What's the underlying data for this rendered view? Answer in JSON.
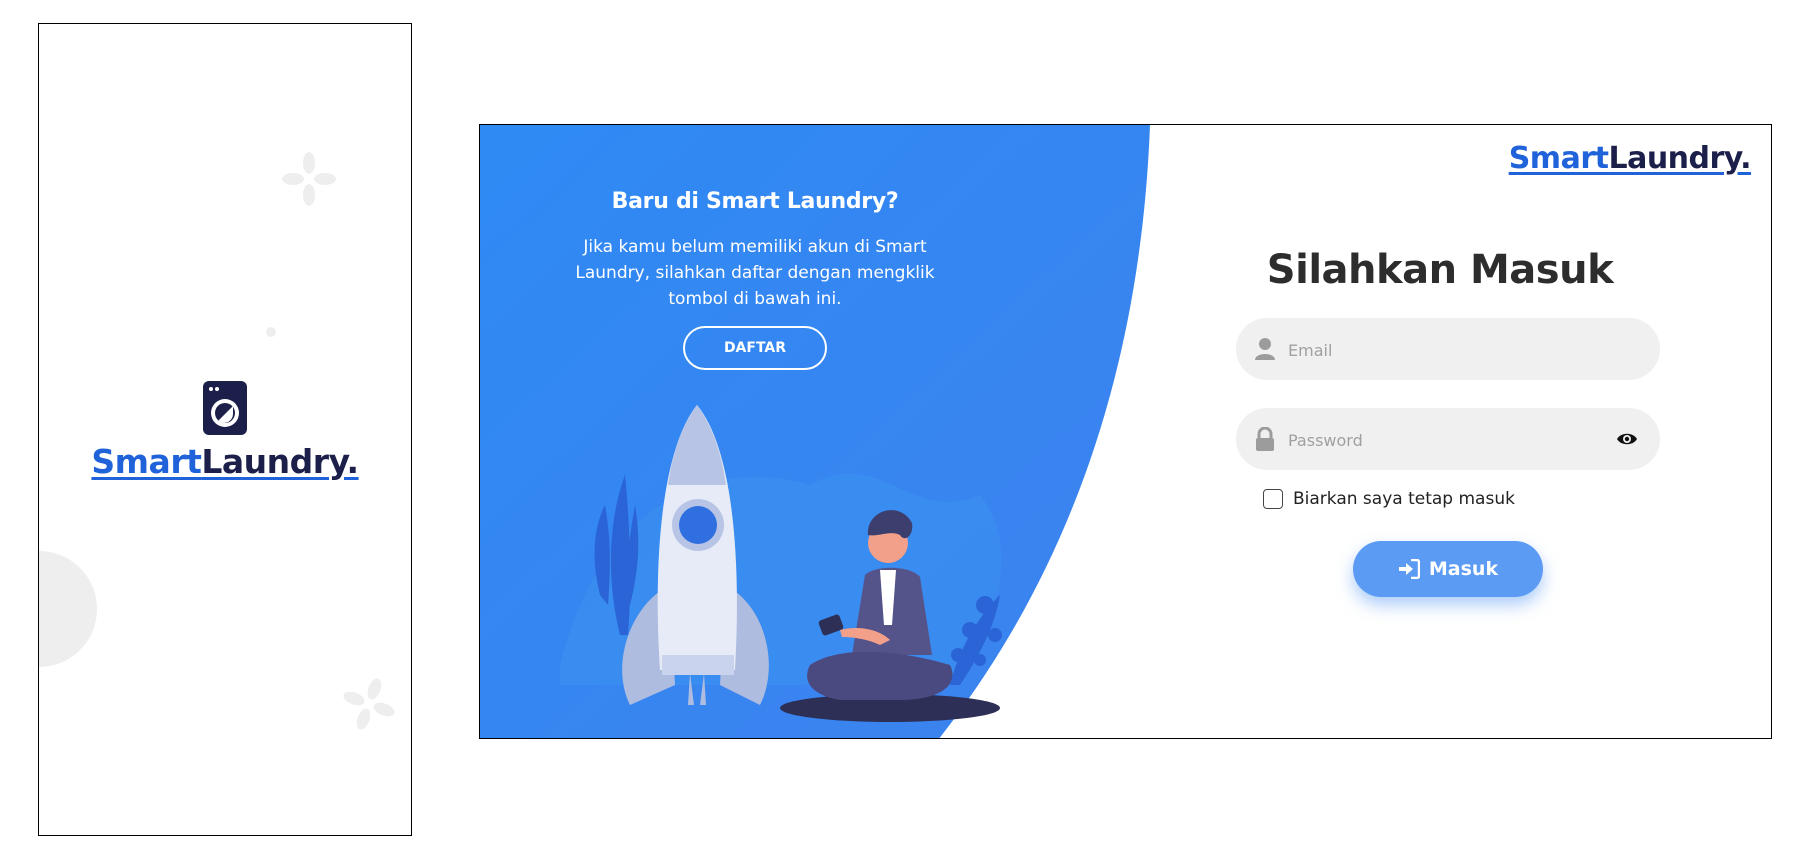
{
  "brand": {
    "part1": "Smart",
    "part2": "Laundry."
  },
  "colors": {
    "primary_blue": "#2f8af4",
    "brand_blue": "#1f62d9",
    "brand_dark": "#1c1f4a",
    "button_blue": "#5b9bf4"
  },
  "signup_panel": {
    "title": "Baru di Smart Laundry?",
    "text": "Jika kamu belum memiliki akun di Smart Laundry, silahkan daftar dengan mengklik tombol di bawah ini.",
    "button_label": "DAFTAR"
  },
  "login": {
    "title": "Silahkan Masuk",
    "email_placeholder": "Email",
    "password_placeholder": "Password",
    "remember_label": "Biarkan saya tetap masuk",
    "submit_label": "Masuk"
  },
  "icons": [
    "washing-machine-icon",
    "user-icon",
    "lock-icon",
    "eye-icon",
    "sign-in-icon"
  ]
}
